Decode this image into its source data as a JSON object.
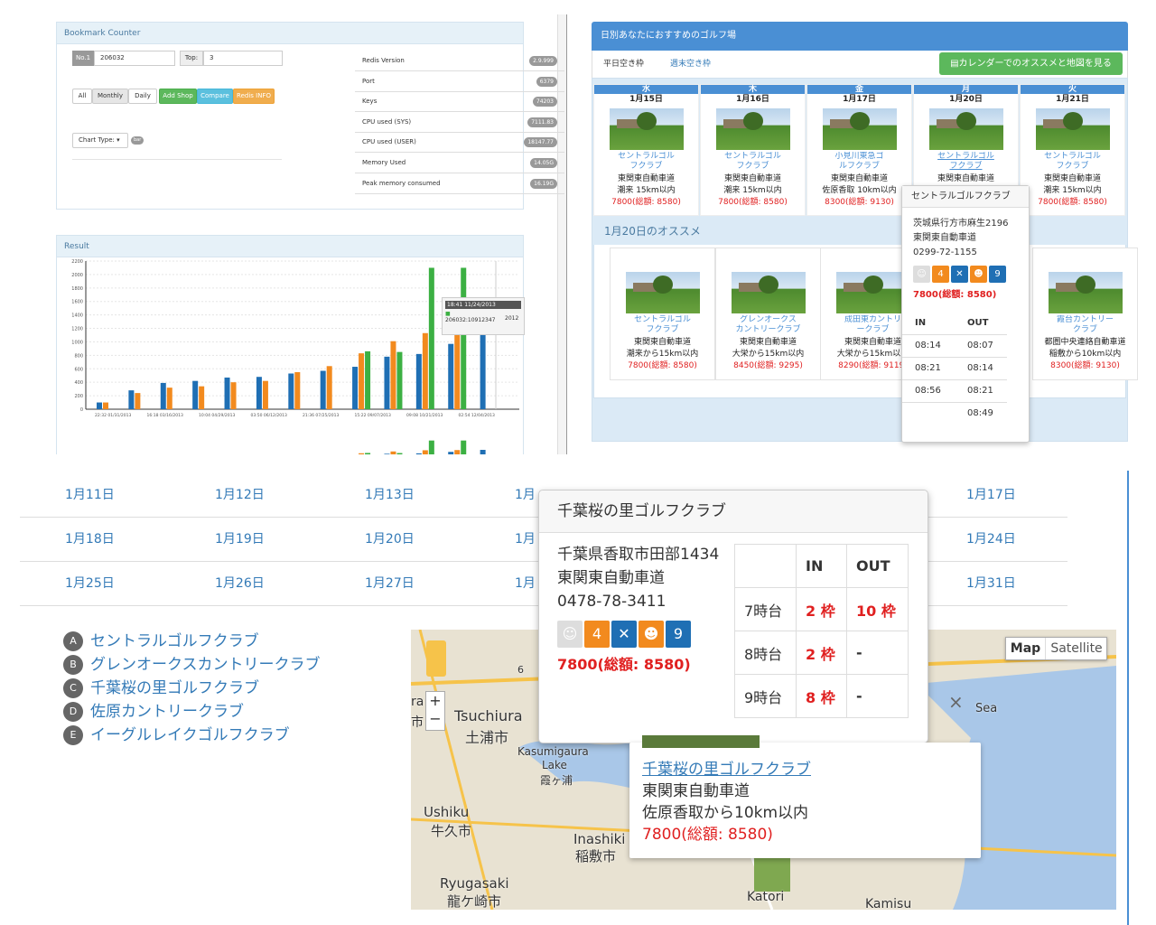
{
  "bookmark": {
    "title": "Bookmark Counter",
    "no_label": "No.1",
    "no_value": "206032",
    "top_label": "Top:",
    "top_value": "3",
    "buttons": [
      "All",
      "Monthly",
      "Daily",
      "Add Shop",
      "Compare",
      "Redis INFO"
    ],
    "chart_type_label": "Chart Type:",
    "chart_type_badge": "bar",
    "stats": [
      {
        "label": "Redis Version",
        "value": "2.9.999"
      },
      {
        "label": "Port",
        "value": "6379"
      },
      {
        "label": "Keys",
        "value": "74203"
      },
      {
        "label": "CPU used (SYS)",
        "value": "7111.83"
      },
      {
        "label": "CPU used (USER)",
        "value": "18147.77"
      },
      {
        "label": "Memory Used",
        "value": "14.05G"
      },
      {
        "label": "Peak memory consumed",
        "value": "16.19G"
      }
    ],
    "result_title": "Result",
    "tooltip_time": "18:41 11/24/2013",
    "tooltip_value": "206032:10912347",
    "tooltip_year": "2012"
  },
  "chart_data": {
    "type": "bar",
    "categories": [
      "22:32 01/31/2013",
      "",
      "16:18 03/16/2013",
      "",
      "10:04 04/29/2013",
      "",
      "03:50 06/12/2013",
      "",
      "21:36 07/25/2013",
      "",
      "15:22 09/07/2013",
      "",
      "09:08 10/21/2013",
      "",
      "02:54 12/04/2013",
      ""
    ],
    "series": [
      {
        "color": "#1f6fb4",
        "values": [
          100,
          280,
          390,
          420,
          470,
          480,
          530,
          570,
          630,
          780,
          820,
          970,
          1170
        ]
      },
      {
        "color": "#f28a1e",
        "values": [
          100,
          240,
          320,
          340,
          400,
          420,
          550,
          640,
          830,
          1010,
          1130,
          1150,
          0
        ]
      },
      {
        "color": "#3cb043",
        "values": [
          0,
          0,
          0,
          0,
          0,
          0,
          0,
          0,
          860,
          850,
          2100,
          2100,
          0
        ]
      }
    ],
    "y_ticks": [
      "0",
      "200",
      "400",
      "600",
      "800",
      "1000",
      "1200",
      "1400",
      "1600",
      "1800",
      "2000",
      "2200"
    ],
    "ylim": [
      0,
      2200
    ]
  },
  "golf": {
    "header": "日別あなたにおすすめのゴルフ場",
    "tab1": "平日空き枠",
    "tab2": "週末空き枠",
    "calendar_button": "カレンダーでのオススメと地図を見る",
    "days": [
      {
        "dow": "水",
        "date": "1月15日",
        "name": "セントラルゴル\nフクラブ",
        "road": "東関東自動車道",
        "dist": "潮来 15km以内",
        "price": "7800(総額: 8580)"
      },
      {
        "dow": "木",
        "date": "1月16日",
        "name": "セントラルゴル\nフクラブ",
        "road": "東関東自動車道",
        "dist": "潮来 15km以内",
        "price": "7800(総額: 8580)"
      },
      {
        "dow": "金",
        "date": "1月17日",
        "name": "小見川東急ゴ\nルフクラブ",
        "road": "東関東自動車道",
        "dist": "佐原香取 10km以内",
        "price": "8300(総額: 9130)"
      },
      {
        "dow": "月",
        "date": "1月20日",
        "name": "セントラルゴル\nフクラブ",
        "road": "東関東自動車道",
        "dist": "",
        "price": ""
      },
      {
        "dow": "火",
        "date": "1月21日",
        "name": "セントラルゴル\nフクラブ",
        "road": "東関東自動車道",
        "dist": "潮来 15km以内",
        "price": "7800(総額: 8580)"
      }
    ],
    "rec_title": "1月20日のオススメ",
    "recs": [
      {
        "name": "セントラルゴル\nフクラブ",
        "road": "東関東自動車道",
        "dist": "潮来から15km以内",
        "price": "7800(総額: 8580)"
      },
      {
        "name": "グレンオークス\nカントリークラブ",
        "road": "東関東自動車道",
        "dist": "大栄から15km以内",
        "price": "8450(総額: 9295)"
      },
      {
        "name": "成田東カントリ\nークラブ",
        "road": "東関東自動車道",
        "dist": "大栄から15km以内",
        "price": "8290(総額: 9119)"
      },
      {
        "name": "霞台カントリー\nクラブ",
        "road": "都圏中央連絡自動車道",
        "dist": "稲敷から10km以内",
        "price": "8300(総額: 9130)"
      }
    ],
    "popup": {
      "name": "セントラルゴルフクラブ",
      "address": "茨城県行方市麻生2196",
      "road": "東関東自動車道",
      "tel": "0299-72-1155",
      "price": "7800(総額: 8580)",
      "in_label": "IN",
      "out_label": "OUT",
      "times": [
        [
          "08:14",
          "08:07"
        ],
        [
          "08:21",
          "08:14"
        ],
        [
          "08:56",
          "08:21"
        ],
        [
          "",
          "08:49"
        ]
      ]
    }
  },
  "calendar": {
    "rows": [
      [
        "1月11日",
        "1月12日",
        "1月13日",
        "1月",
        "1月17日"
      ],
      [
        "1月18日",
        "1月19日",
        "1月20日",
        "1月",
        "1月24日"
      ],
      [
        "1月25日",
        "1月26日",
        "1月27日",
        "1月",
        "1月31日"
      ]
    ]
  },
  "legend": [
    {
      "marker": "A",
      "name": "セントラルゴルフクラブ"
    },
    {
      "marker": "B",
      "name": "グレンオークスカントリークラブ"
    },
    {
      "marker": "C",
      "name": "千葉桜の里ゴルフクラブ"
    },
    {
      "marker": "D",
      "name": "佐原カントリークラブ"
    },
    {
      "marker": "E",
      "name": "イーグルレイクゴルフクラブ"
    }
  ],
  "map": {
    "map_btn": "Map",
    "satellite_btn": "Satellite",
    "places": [
      "Tsuchiura",
      "土浦市",
      "Kasumigaura",
      "Lake",
      "霞ヶ浦",
      "Ushiku",
      "牛久市",
      "Inashiki",
      "稲敷市",
      "Ryugasaki",
      "龍ケ崎市",
      "Katori",
      "Kamisu",
      "Sea",
      "6",
      "ra",
      "市"
    ],
    "info_name": "千葉桜の里ゴルフクラブ",
    "info_road": "東関東自動車道",
    "info_dist": "佐原香取から10km以内",
    "info_price": "7800(総額: 8580)",
    "close": "×",
    "plus": "+",
    "minus": "−"
  },
  "popup2": {
    "name": "千葉桜の里ゴルフクラブ",
    "address": "千葉県香取市田部1434",
    "road": "東関東自動車道",
    "tel": "0478-78-3411",
    "price": "7800(総額: 8580)",
    "in_label": "IN",
    "out_label": "OUT",
    "rows": [
      {
        "time": "7時台",
        "in": "2 枠",
        "out": "10 枠"
      },
      {
        "time": "8時台",
        "in": "2 枠",
        "out": "-"
      },
      {
        "time": "9時台",
        "in": "8 枠",
        "out": "-"
      }
    ]
  }
}
